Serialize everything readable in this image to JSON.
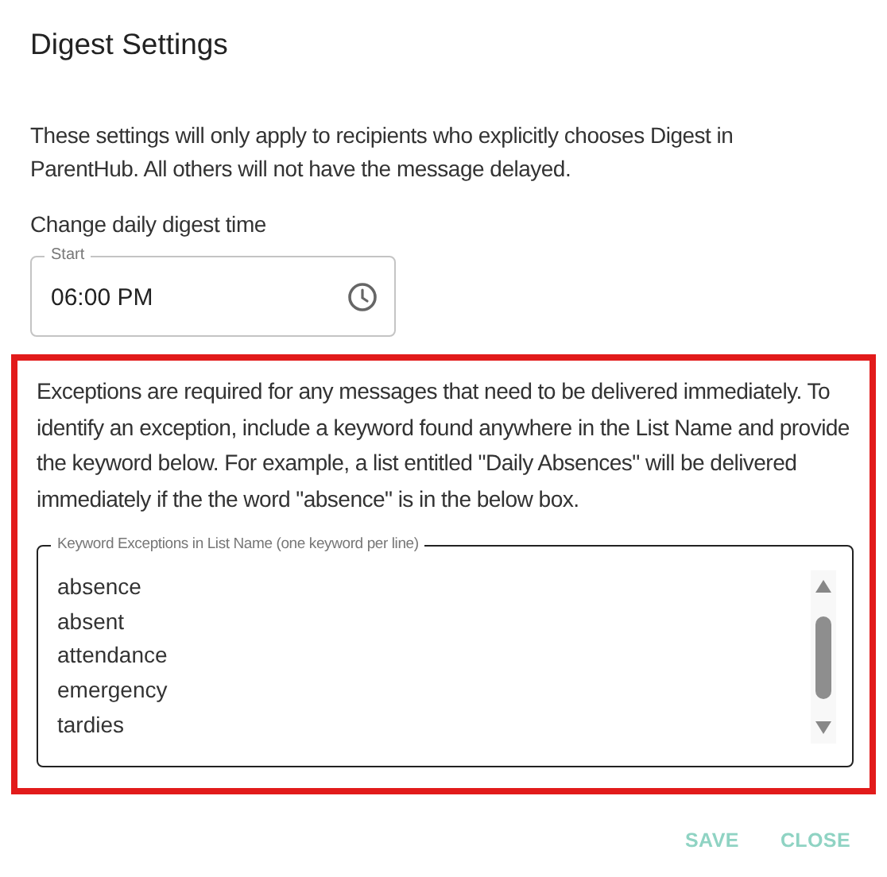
{
  "dialog": {
    "title": "Digest Settings"
  },
  "intro": "These settings will only apply to recipients who explicitly chooses Digest in ParentHub. All others will not have the message delayed.",
  "time_section": {
    "label": "Change daily digest time",
    "field": {
      "label": "Start",
      "value": "06:00 PM"
    }
  },
  "exceptions": {
    "highlighted": true,
    "description": "Exceptions are required for any messages that need to be delivered immediately. To identify an exception, include a keyword found anywhere in the List Name and provide the keyword below. For example, a list entitled \"Daily Absences\" will be delivered immediately if the the word \"absence\" is in the below box.",
    "field": {
      "label": "Keyword Exceptions in List Name (one keyword per line)",
      "keywords": [
        "absence",
        "absent",
        "attendance",
        "emergency",
        "tardies"
      ]
    }
  },
  "buttons": [
    {
      "label": "SAVE",
      "disabled": true
    },
    {
      "label": "CLOSE",
      "disabled": true
    }
  ]
}
